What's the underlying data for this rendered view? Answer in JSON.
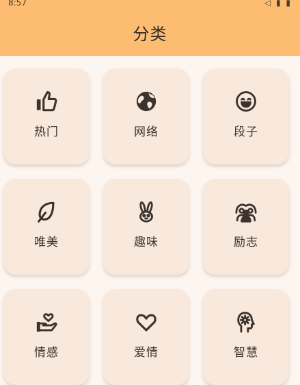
{
  "statusbar": {
    "time": "8:57",
    "system_icons": "◁ ▮ ▮"
  },
  "header": {
    "title": "分类"
  },
  "categories": [
    {
      "label": "热门",
      "icon": "thumbs-up-icon"
    },
    {
      "label": "网络",
      "icon": "globe-icon"
    },
    {
      "label": "段子",
      "icon": "smile-icon"
    },
    {
      "label": "唯美",
      "icon": "leaf-icon"
    },
    {
      "label": "趣味",
      "icon": "rabbit-icon"
    },
    {
      "label": "励志",
      "icon": "group-icon"
    },
    {
      "label": "情感",
      "icon": "hand-heart-icon"
    },
    {
      "label": "爱情",
      "icon": "heart-icon"
    },
    {
      "label": "智慧",
      "icon": "brain-gear-icon"
    }
  ],
  "colors": {
    "header_bg": "#fcbd73",
    "page_bg": "#fdf5f0",
    "tile_bg": "#f9e8dc",
    "text": "#3a332e"
  }
}
